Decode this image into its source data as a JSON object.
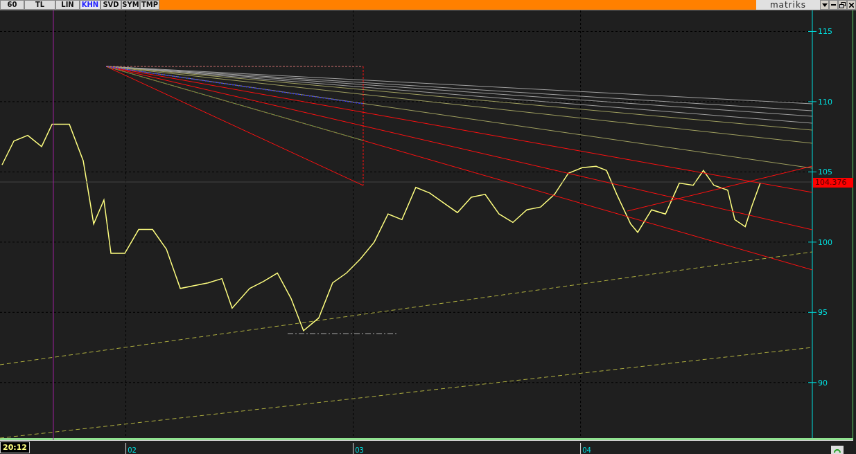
{
  "toolbar": {
    "buttons": [
      {
        "label": "60",
        "selected": false
      },
      {
        "label": "TL",
        "selected": false
      },
      {
        "label": "LIN",
        "selected": false
      },
      {
        "label": "KHN",
        "selected": true
      },
      {
        "label": "SVD",
        "selected": false
      },
      {
        "label": "SYM",
        "selected": false
      },
      {
        "label": "TMP",
        "selected": false
      }
    ]
  },
  "brand": "matriks",
  "chart": {
    "price_label": "104.376",
    "time_label": "20:12",
    "chart_data": {
      "type": "line",
      "x": [
        1.428,
        1.48,
        1.541,
        1.602,
        1.648,
        1.724,
        1.785,
        1.831,
        1.876,
        1.907,
        1.968,
        2.029,
        2.09,
        2.151,
        2.212,
        2.273,
        2.334,
        2.395,
        2.44,
        2.517,
        2.578,
        2.639,
        2.699,
        2.754,
        2.821,
        2.882,
        2.943,
        3.004,
        3.065,
        3.126,
        3.187,
        3.248,
        3.309,
        3.37,
        3.431,
        3.492,
        3.553,
        3.614,
        3.675,
        3.736,
        3.797,
        3.858,
        3.919,
        3.98,
        4.041,
        4.087,
        4.132,
        4.193,
        4.224,
        4.285,
        4.346,
        4.407,
        4.468,
        4.513,
        4.559,
        4.62,
        4.651,
        4.697,
        4.727,
        4.763
      ],
      "series": [
        {
          "color": "#ffff80",
          "values": [
            105.5,
            107.2,
            107.6,
            106.8,
            108.4,
            108.4,
            105.8,
            101.3,
            103.0,
            99.2,
            99.2,
            100.9,
            100.9,
            99.5,
            96.7,
            96.9,
            97.1,
            97.4,
            95.3,
            96.7,
            97.2,
            97.8,
            96.0,
            93.7,
            94.6,
            97.1,
            97.8,
            98.8,
            100.0,
            102.0,
            101.6,
            103.9,
            103.5,
            102.8,
            102.1,
            103.2,
            103.4,
            102.0,
            101.4,
            102.3,
            102.5,
            103.4,
            104.9,
            105.3,
            105.4,
            105.1,
            103.4,
            101.3,
            100.7,
            102.3,
            102.0,
            104.2,
            104.05,
            105.1,
            104.05,
            103.7,
            101.6,
            101.1,
            102.6,
            104.2
          ]
        }
      ],
      "grid": true,
      "xlim": [
        1.419,
        5.172
      ],
      "ylim": [
        85.9,
        116.5
      ],
      "xticks": [
        {
          "value": 2,
          "label": "02"
        },
        {
          "value": 3,
          "label": "03"
        },
        {
          "value": 4,
          "label": "04"
        }
      ],
      "yticks": [
        {
          "value": 90,
          "label": "90"
        },
        {
          "value": 95,
          "label": "95"
        },
        {
          "value": 100,
          "label": "100"
        },
        {
          "value": 105,
          "label": "105"
        },
        {
          "value": 110,
          "label": "110"
        },
        {
          "value": 115,
          "label": "115"
        }
      ]
    }
  }
}
